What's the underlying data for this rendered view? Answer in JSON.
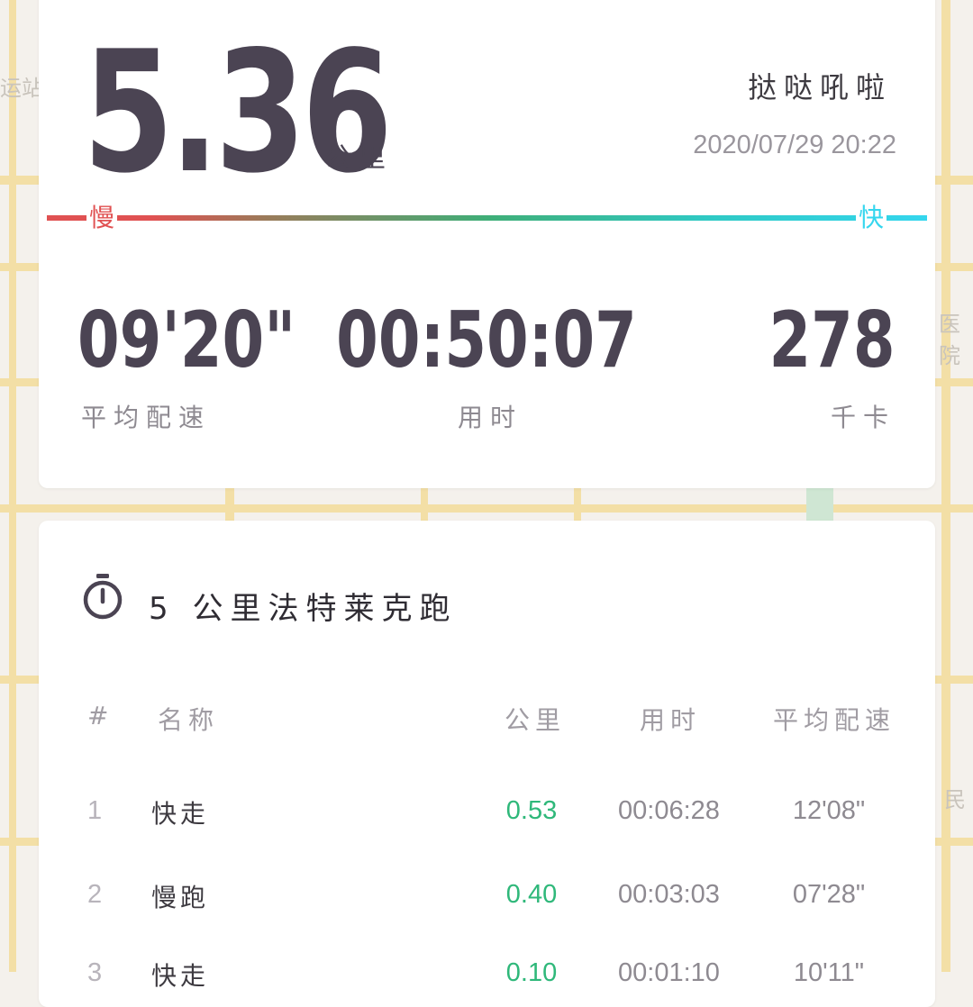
{
  "map": {
    "labels": [
      "运站",
      "医院",
      "民"
    ]
  },
  "summary": {
    "distance": "5.36",
    "distance_unit": "公里",
    "username": "挞哒吼啦",
    "datetime": "2020/07/29 20:22",
    "pace_slow_label": "慢",
    "pace_fast_label": "快",
    "avg_pace": "09'20\"",
    "avg_pace_label": "平均配速",
    "duration": "00:50:07",
    "duration_label": "用时",
    "calories": "278",
    "calories_label": "千卡"
  },
  "workout": {
    "icon": "stopwatch-icon",
    "title": "5 公里法特莱克跑",
    "headers": {
      "index": "#",
      "name": "名称",
      "distance": "公里",
      "duration": "用时",
      "avg_pace": "平均配速"
    },
    "rows": [
      {
        "index": "1",
        "name": "快走",
        "distance": "0.53",
        "duration": "00:06:28",
        "pace": "12'08\""
      },
      {
        "index": "2",
        "name": "慢跑",
        "distance": "0.40",
        "duration": "00:03:03",
        "pace": "07'28\""
      },
      {
        "index": "3",
        "name": "快走",
        "distance": "0.10",
        "duration": "00:01:10",
        "pace": "10'11\""
      }
    ]
  },
  "colors": {
    "slow": "#e05152",
    "fast": "#34d6ee",
    "distance_value": "#2fb87a",
    "primary_text": "#4b4453"
  }
}
